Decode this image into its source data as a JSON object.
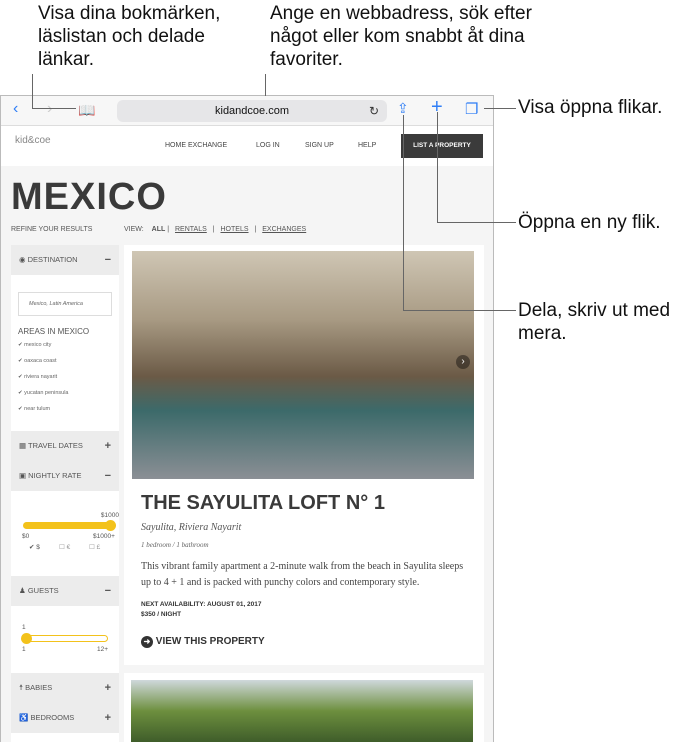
{
  "callouts": {
    "bookmarks": "Visa dina bokmärken, läslistan och delade länkar.",
    "address": "Ange en webbadress, sök efter något eller kom snabbt åt dina favoriter.",
    "tabs": "Visa öppna flikar.",
    "new_tab": "Öppna en ny flik.",
    "share": "Dela, skriv ut med mera."
  },
  "toolbar": {
    "url": "kidandcoe.com",
    "accent": "#2f7ef6"
  },
  "site": {
    "logo": "kid&coe",
    "nav": [
      "HOME EXCHANGE",
      "LOG IN",
      "SIGN UP",
      "HELP"
    ],
    "list_button": "LIST A PROPERTY",
    "title": "MEXICO",
    "refine": "REFINE YOUR RESULTS",
    "view_label": "VIEW:",
    "view_options": [
      "ALL",
      "RENTALS",
      "HOTELS",
      "EXCHANGES"
    ]
  },
  "sidebar": {
    "destination": "DESTINATION",
    "destination_value": "Mexico, Latin America",
    "areas_title": "AREAS IN MEXICO",
    "areas": [
      "mexico city",
      "oaxaca coast",
      "riviera nayarit",
      "yucatan peninsula",
      "near tulum"
    ],
    "travel_dates": "TRAVEL DATES",
    "nightly_rate": "NIGHTLY RATE",
    "rate_value": "$1000",
    "rate_min": "$0",
    "rate_max": "$1000+",
    "currencies": [
      "$",
      "€",
      "£"
    ],
    "guests": "GUESTS",
    "guests_value": "1",
    "guests_min": "1",
    "guests_max": "12+",
    "babies": "BABIES",
    "bedrooms": "BEDROOMS",
    "slider_color": "#f3c21b"
  },
  "listing": {
    "name": "THE SAYULITA LOFT N° 1",
    "location": "Sayulita, Riviera Nayarit",
    "rooms": "1 bedroom / 1 bathroom",
    "description": "This vibrant family apartment a 2-minute walk from the beach in Sayulita sleeps up to 4 + 1 and is packed with punchy colors and contemporary style.",
    "availability": "NEXT AVAILABILITY: AUGUST 01, 2017",
    "price": "$350 / NIGHT",
    "cta": "VIEW THIS PROPERTY"
  }
}
